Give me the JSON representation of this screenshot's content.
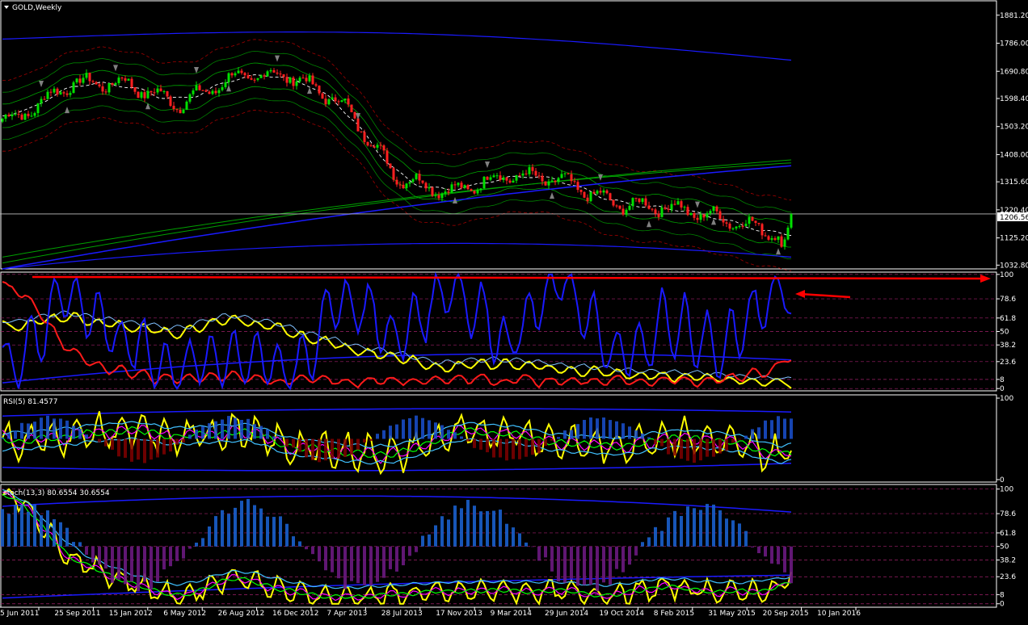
{
  "window": {
    "title": "GOLD,Weekly",
    "current_price": "1206.56",
    "colors": {
      "background": "#000000",
      "bull_candle": "#00e000",
      "bear_candle": "#ff2020",
      "axis": "#ffffff",
      "price_line": "#c0c0c0"
    }
  },
  "panes": [
    {
      "id": "price",
      "label": "GOLD,Weekly",
      "ticks": [
        "1881.20",
        "1786.00",
        "1690.80",
        "1598.40",
        "1503.20",
        "1408.00",
        "1315.60",
        "1220.40",
        "1125.20",
        "1032.80"
      ],
      "tick_values": [
        1881.2,
        1786.0,
        1690.8,
        1598.4,
        1503.2,
        1408.0,
        1315.6,
        1220.4,
        1125.2,
        1032.8
      ],
      "ylim": [
        1020,
        1930
      ]
    },
    {
      "id": "osc1",
      "label": "",
      "ticks": [
        "100",
        "78.6",
        "61.8",
        "50",
        "38.2",
        "23.6",
        "8",
        "0"
      ],
      "tick_values": [
        100,
        78.6,
        61.8,
        50,
        38.2,
        23.6,
        8,
        0
      ],
      "ylim": [
        -2,
        102
      ]
    },
    {
      "id": "rsi",
      "label": "RSI(5) 81.4577",
      "ticks": [
        "100",
        "0"
      ],
      "tick_values": [
        100,
        0
      ],
      "ylim": [
        -3,
        104
      ]
    },
    {
      "id": "stoch",
      "label": "stoch(13,3) 80.6554 30.6554",
      "ticks": [
        "100",
        "78.6",
        "61.8",
        "50",
        "38.2",
        "23.6",
        "8",
        "0"
      ],
      "tick_values": [
        100,
        78.6,
        61.8,
        50,
        38.2,
        23.6,
        8,
        0
      ],
      "ylim": [
        -3,
        104
      ]
    }
  ],
  "x_axis": {
    "labels": [
      "5 Jun 2011",
      "25 Sep 2011",
      "15 Jan 2012",
      "6 May 2012",
      "26 Aug 2012",
      "16 Dec 2012",
      "7 Apr 2013",
      "28 Jul 2013",
      "17 Nov 2013",
      "9 Mar 2014",
      "29 Jun 2014",
      "19 Oct 2014",
      "8 Feb 2015",
      "31 May 2015",
      "20 Sep 2015",
      "10 Jan 2016"
    ]
  },
  "chart_data": {
    "type": "line",
    "title": "GOLD,Weekly",
    "x_label_dates": [
      "5 Jun 2011",
      "25 Sep 2011",
      "15 Jan 2012",
      "6 May 2012",
      "26 Aug 2012",
      "16 Dec 2012",
      "7 Apr 2013",
      "28 Jul 2013",
      "17 Nov 2013",
      "9 Mar 2014",
      "29 Jun 2014",
      "19 Oct 2014",
      "8 Feb 2015",
      "31 May 2015",
      "20 Sep 2015",
      "10 Jan 2016"
    ],
    "price_close_at_labels": [
      1530,
      1650,
      1650,
      1580,
      1670,
      1680,
      1580,
      1330,
      1280,
      1340,
      1320,
      1240,
      1230,
      1190,
      1140,
      1100
    ],
    "last_close": 1206.56,
    "price_range": [
      1032.8,
      1881.2
    ],
    "series": [
      {
        "name": "RSI(5) 81.4577",
        "values_at_labels": [
          45,
          55,
          60,
          50,
          62,
          40,
          35,
          30,
          55,
          60,
          45,
          40,
          55,
          45,
          30,
          81
        ]
      },
      {
        "name": "stoch(13,3) 80.6554 30.6554",
        "values_at_labels": [
          95,
          40,
          20,
          5,
          25,
          10,
          5,
          8,
          10,
          12,
          10,
          8,
          15,
          10,
          12,
          81
        ]
      }
    ]
  }
}
